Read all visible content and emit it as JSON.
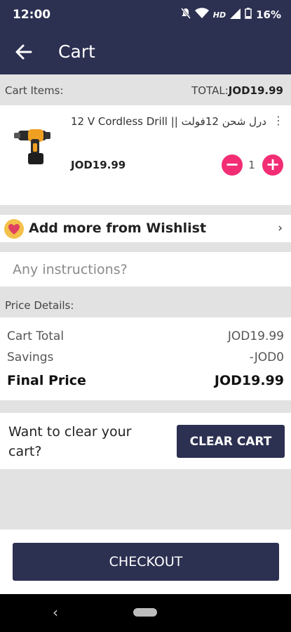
{
  "status_bar": {
    "time": "12:00",
    "battery": "16%"
  },
  "app_bar": {
    "title": "Cart"
  },
  "cart": {
    "items_label": "Cart Items:",
    "total_label": "TOTAL:",
    "total_value": "JOD19.99",
    "items": [
      {
        "name": "12 V Cordless Drill || درل شحن 12فولت",
        "price": "JOD19.99",
        "quantity": "1"
      }
    ]
  },
  "wishlist": {
    "label": "Add more from Wishlist"
  },
  "instructions": {
    "placeholder": "Any instructions?"
  },
  "price_details": {
    "header": "Price Details:",
    "rows": [
      {
        "label": "Cart Total",
        "value": "JOD19.99"
      },
      {
        "label": "Savings",
        "value": "-JOD0"
      }
    ],
    "final": {
      "label": "Final Price",
      "value": "JOD19.99"
    }
  },
  "clear_cart": {
    "prompt": "Want to clear your cart?",
    "button": "CLEAR CART"
  },
  "checkout": {
    "button": "CHECKOUT"
  },
  "colors": {
    "primary": "#2c3051",
    "accent": "#f22d74",
    "wishlist_icon": "#f3c04a",
    "background": "#e2e2e2"
  }
}
